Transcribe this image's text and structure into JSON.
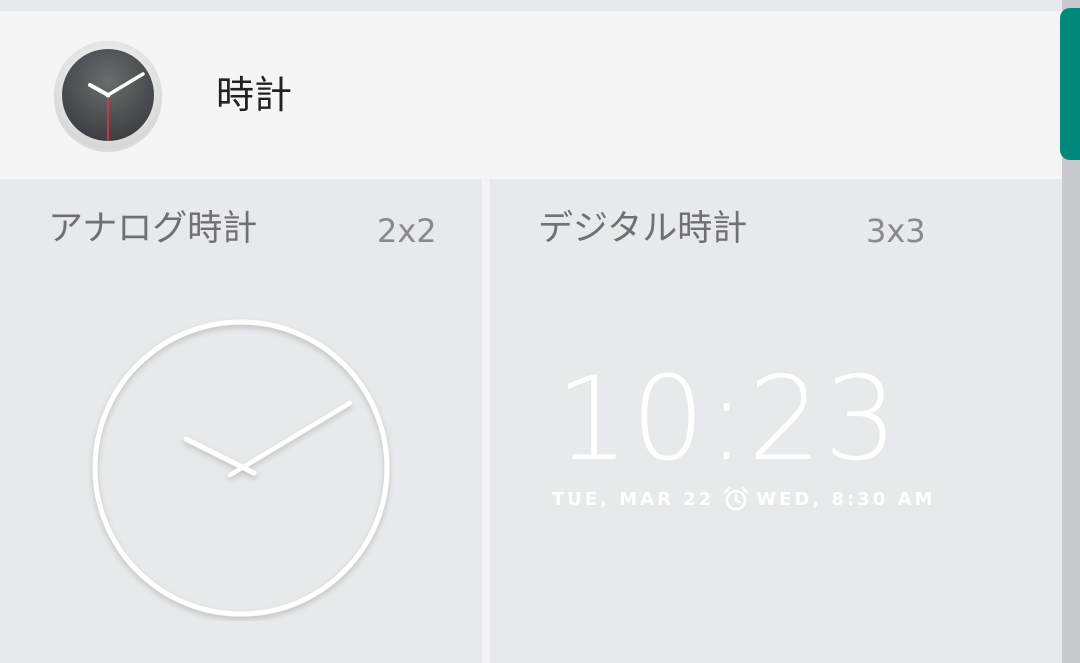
{
  "app": {
    "title": "時計",
    "icon": "analog-clock-icon"
  },
  "widgets": [
    {
      "name": "アナログ時計",
      "size": "2x2",
      "preview": "analog-clock"
    },
    {
      "name": "デジタル時計",
      "size": "3x3",
      "preview": {
        "time": "10:23",
        "date": "TUE, MAR 22",
        "alarm": "WED, 8:30 AM",
        "alarm_icon": "alarm-clock-icon"
      }
    }
  ],
  "colors": {
    "header_bg": "#f5f5f5",
    "card_bg": "#e8e9ec",
    "scrollbar_accent": "#00897b",
    "second_hand": "#e53935"
  }
}
